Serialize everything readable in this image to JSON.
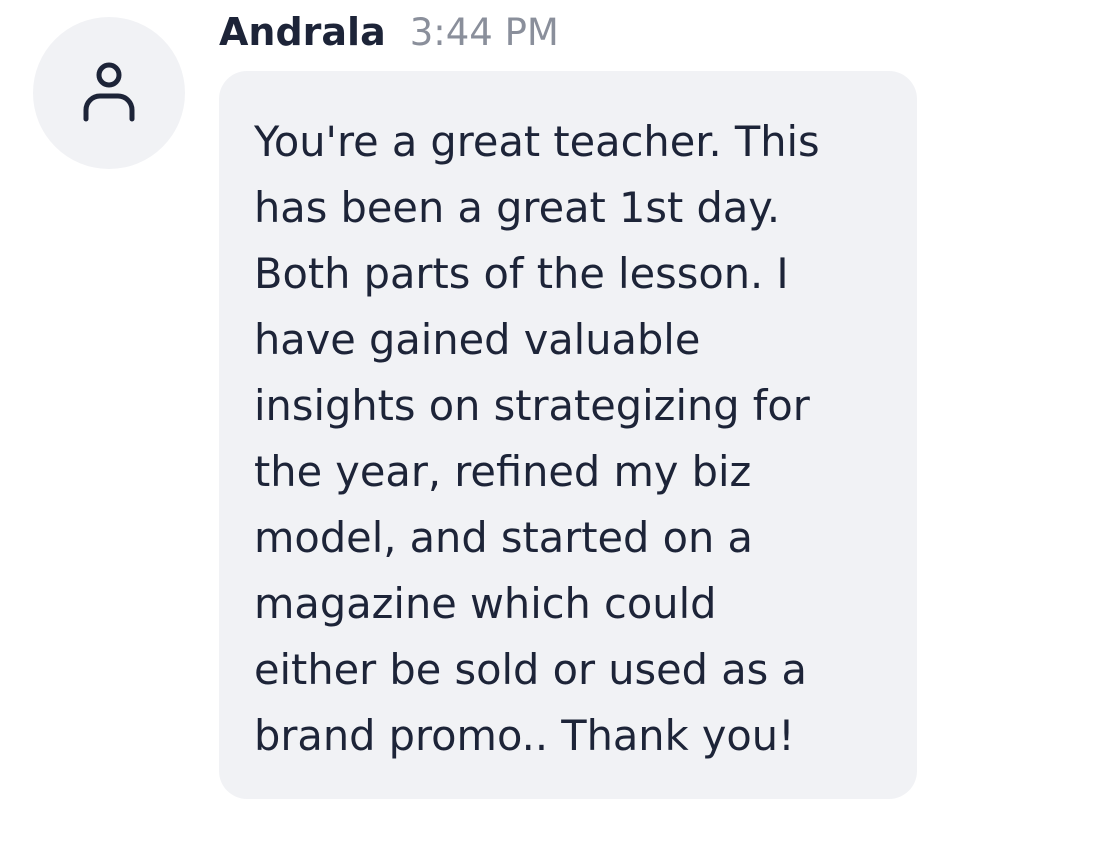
{
  "message": {
    "sender": "Andrala",
    "time": "3:44 PM",
    "avatar_icon": "user-outline-icon",
    "text": "You're a great teacher.  This\nhas been a great 1st day.\nBoth parts of the lesson.  I\nhave gained valuable\ninsights on strategizing for\nthe year, refined my biz\nmodel, and started on a\nmagazine which could\neither be sold or used as a\nbrand promo..  Thank you!"
  },
  "colors": {
    "text": "#1d2438",
    "timestamp": "#8a8f9b",
    "bubble_background": "#f1f2f5",
    "avatar_background": "#f1f2f5"
  }
}
